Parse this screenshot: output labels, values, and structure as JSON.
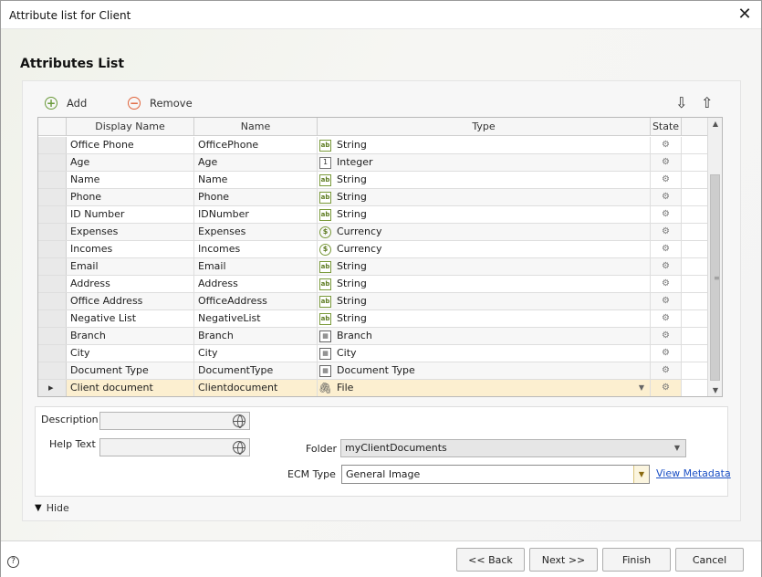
{
  "window": {
    "title": "Attribute list for Client"
  },
  "section_title": "Attributes List",
  "toolbar": {
    "add_label": "Add",
    "remove_label": "Remove"
  },
  "grid": {
    "columns": [
      "Display Name",
      "Name",
      "Type",
      "State"
    ],
    "rows": [
      {
        "display_name": "Office Phone",
        "name": "OfficePhone",
        "type": "String",
        "type_icon": "string-icon"
      },
      {
        "display_name": "Age",
        "name": "Age",
        "type": "Integer",
        "type_icon": "integer-icon"
      },
      {
        "display_name": "Name",
        "name": "Name",
        "type": "String",
        "type_icon": "string-icon"
      },
      {
        "display_name": "Phone",
        "name": "Phone",
        "type": "String",
        "type_icon": "string-icon"
      },
      {
        "display_name": "ID Number",
        "name": "IDNumber",
        "type": "String",
        "type_icon": "string-icon"
      },
      {
        "display_name": "Expenses",
        "name": "Expenses",
        "type": "Currency",
        "type_icon": "currency-icon"
      },
      {
        "display_name": "Incomes",
        "name": "Incomes",
        "type": "Currency",
        "type_icon": "currency-icon"
      },
      {
        "display_name": "Email",
        "name": "Email",
        "type": "String",
        "type_icon": "string-icon"
      },
      {
        "display_name": "Address",
        "name": "Address",
        "type": "String",
        "type_icon": "string-icon"
      },
      {
        "display_name": "Office Address",
        "name": "OfficeAddress",
        "type": "String",
        "type_icon": "string-icon"
      },
      {
        "display_name": "Negative List",
        "name": "NegativeList",
        "type": "String",
        "type_icon": "string-icon"
      },
      {
        "display_name": "Branch",
        "name": "Branch",
        "type": "Branch",
        "type_icon": "entity-icon"
      },
      {
        "display_name": "City",
        "name": "City",
        "type": "City",
        "type_icon": "entity-icon"
      },
      {
        "display_name": "Document Type",
        "name": "DocumentType",
        "type": "Document Type",
        "type_icon": "entity-icon"
      },
      {
        "display_name": "Client document",
        "name": "Clientdocument",
        "type": "File",
        "type_icon": "paperclip-icon",
        "selected": true
      }
    ]
  },
  "details": {
    "description_label": "Description",
    "help_text_label": "Help Text",
    "folder_label": "Folder",
    "folder_value": "myClientDocuments",
    "ecm_type_label": "ECM Type",
    "ecm_type_value": "General Image",
    "view_metadata_link": "View Metadata"
  },
  "hide_toggle_label": "Hide",
  "footer": {
    "back_label": "<< Back",
    "next_label": "Next >>",
    "finish_label": "Finish",
    "cancel_label": "Cancel"
  },
  "colors": {
    "selected_row": "#fcefd0",
    "link": "#1a4fc5",
    "add_icon": "#6a9a3a",
    "remove_icon": "#e0633a"
  }
}
